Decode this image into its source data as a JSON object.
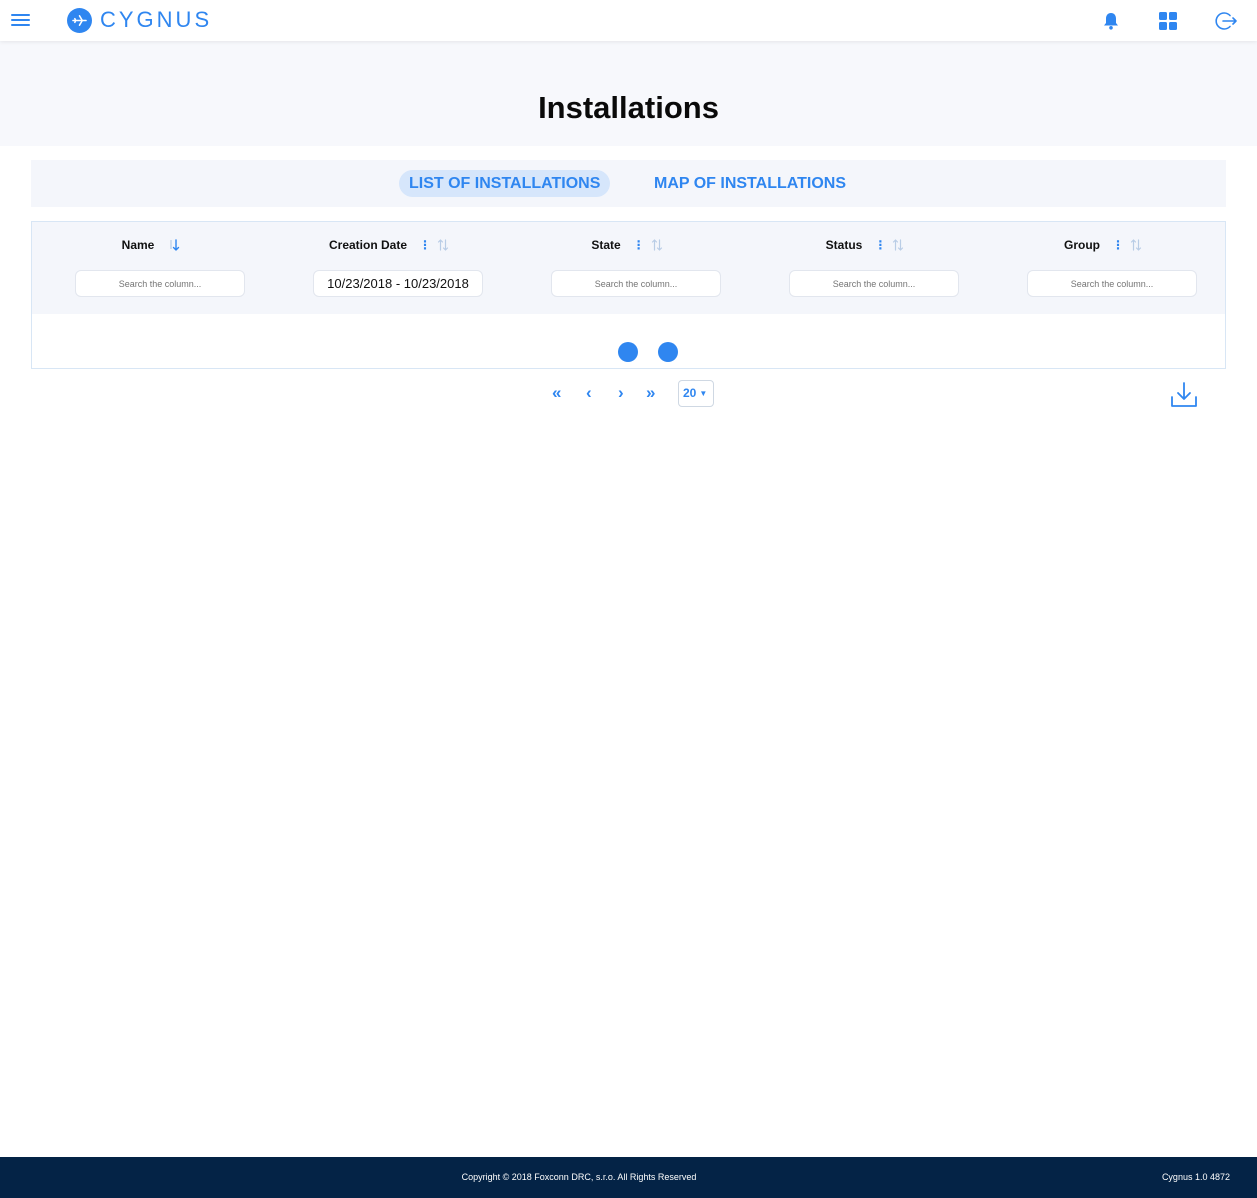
{
  "app": {
    "name": "CYGNUS",
    "brand_color": "#2f86f0",
    "footer_color": "#042346"
  },
  "header": {
    "menu_icon": "hamburger-icon",
    "logo_icon": "plane-icon",
    "actions": [
      {
        "name": "notifications",
        "icon": "bell-icon"
      },
      {
        "name": "apps",
        "icon": "grid-icon"
      },
      {
        "name": "logout",
        "icon": "logout-icon"
      }
    ]
  },
  "page": {
    "title": "Installations"
  },
  "tabs": [
    {
      "label": "LIST OF INSTALLATIONS",
      "active": true
    },
    {
      "label": "MAP OF INSTALLATIONS",
      "active": false
    }
  ],
  "table": {
    "columns": [
      {
        "label": "Name",
        "sort": "descending",
        "has_menu": false,
        "filter_value": "",
        "filter_placeholder": "Search the column..."
      },
      {
        "label": "Creation Date",
        "sort": "none",
        "has_menu": true,
        "filter_value": "10/23/2018 - 10/23/2018",
        "filter_placeholder": ""
      },
      {
        "label": "State",
        "sort": "none",
        "has_menu": true,
        "filter_value": "",
        "filter_placeholder": "Search the column..."
      },
      {
        "label": "Status",
        "sort": "none",
        "has_menu": true,
        "filter_value": "",
        "filter_placeholder": "Search the column..."
      },
      {
        "label": "Group",
        "sort": "none",
        "has_menu": true,
        "filter_value": "",
        "filter_placeholder": "Search the column..."
      }
    ],
    "loading": true
  },
  "pagination": {
    "first": "«",
    "prev": "‹",
    "next": "›",
    "last": "»",
    "per_page": "20",
    "download_icon": "download-icon"
  },
  "footer": {
    "copyright": "Copyright © 2018 Foxconn DRC, s.r.o. All Rights Reserved",
    "version": "Cygnus 1.0 4872"
  }
}
